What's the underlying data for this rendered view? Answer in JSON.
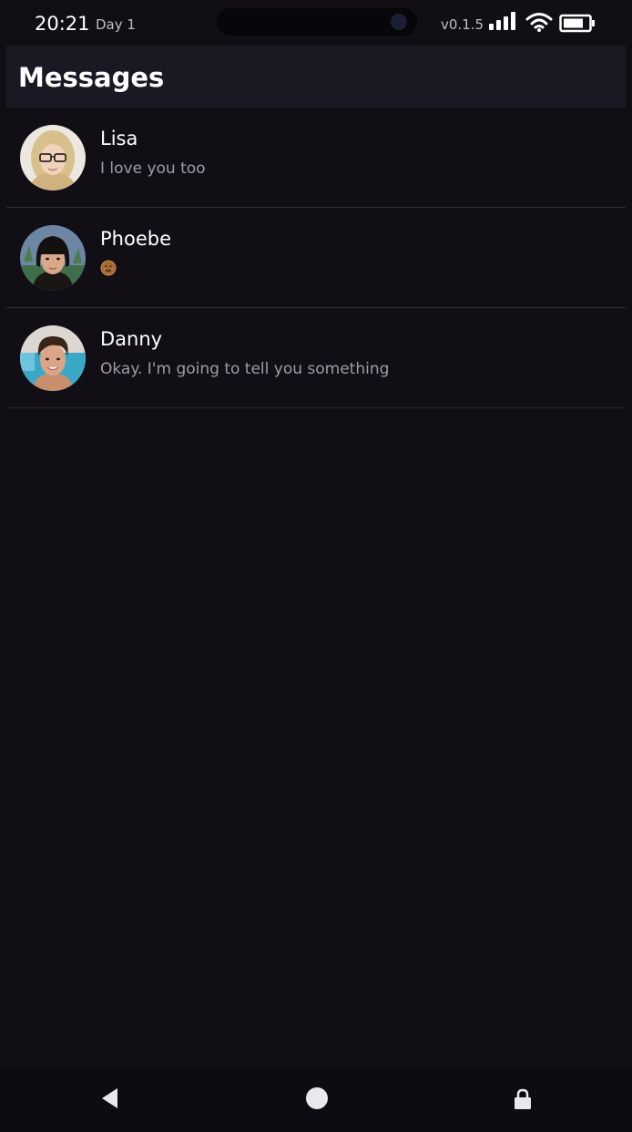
{
  "status_bar": {
    "time": "20:21",
    "day": "Day 1",
    "version": "v0.1.5",
    "icons": [
      "signal-icon",
      "wifi-icon",
      "battery-icon"
    ]
  },
  "header": {
    "title": "Messages"
  },
  "conversations": [
    {
      "name": "Lisa",
      "preview": "I love you too"
    },
    {
      "name": "Phoebe",
      "preview": "",
      "preview_icon": "smiling-face-emoji"
    },
    {
      "name": "Danny",
      "preview": "Okay. I'm going to tell you something"
    }
  ],
  "nav_bar": {
    "buttons": [
      "back-icon",
      "home-icon",
      "lock-icon"
    ]
  },
  "colors": {
    "background": "#110e16",
    "header": "#1a1823",
    "preview_text": "#9f9ba8",
    "divider": "#2e2b36"
  }
}
